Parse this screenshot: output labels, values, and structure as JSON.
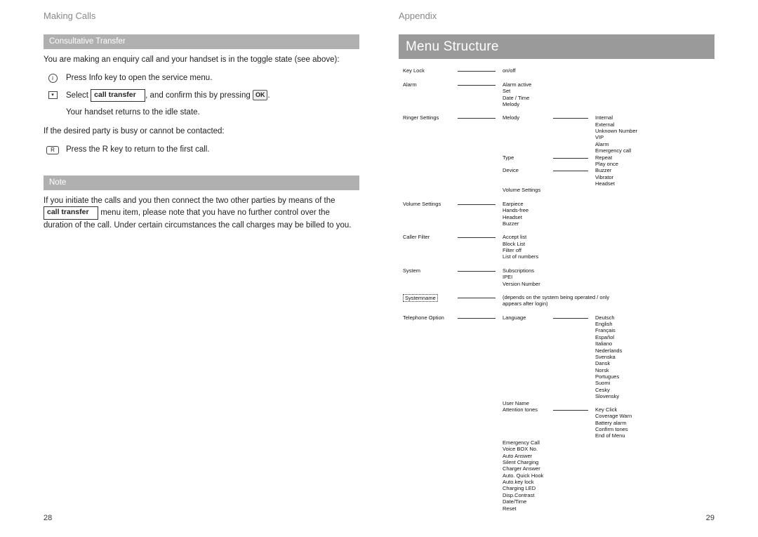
{
  "left": {
    "heading": "Making Calls",
    "consultative_heading": "Consultative Transfer",
    "intro": "You are making an enquiry call and your handset is in the toggle state (see above):",
    "step1": "Press Info key to open the service menu.",
    "step2a": "Select",
    "step2_box": "call transfer",
    "step2b": ", and confirm this by pressing",
    "ok_label": "OK",
    "step2c": ".",
    "step3": "Your handset returns to the idle state.",
    "busy_intro": "If the desired party is busy or cannot be contacted:",
    "busy_step": "Press the R key to return to the first call.",
    "note_heading": "Note",
    "note1": "If you initiate the calls and you then connect the two other parties by means of the",
    "note_box": "call transfer",
    "note2": " menu item, please note that you have no further control over the duration of the call. Under certain circumstances the call charges may be billed to you.",
    "page_num": "28"
  },
  "right": {
    "heading": "Appendix",
    "title": "Menu Structure",
    "page_num": "29",
    "menu": {
      "keylock": {
        "label": "Key Lock",
        "items": [
          "on/off"
        ]
      },
      "alarm": {
        "label": "Alarm",
        "items": [
          "Alarm active",
          "Set",
          "Date / Time",
          "Melody"
        ]
      },
      "ringer": {
        "label": "Ringer Settings",
        "melody": {
          "label": "Melody",
          "items": [
            "Internal",
            "External",
            "Unknown Number",
            "VIP",
            "Alarm",
            "Emergency call"
          ]
        },
        "type": {
          "label": "Type",
          "items": [
            "Repeat",
            "Play once"
          ]
        },
        "device": {
          "label": "Device",
          "items": [
            "Buzzer",
            "Vibrator",
            "Headset"
          ]
        },
        "last": "Volume Settings"
      },
      "volume": {
        "label": "Volume Settings",
        "items": [
          "Earpiece",
          "Hands-free",
          "Headset",
          "Buzzer"
        ]
      },
      "caller": {
        "label": "Caller Filter",
        "items": [
          "Accept list",
          "Block List",
          "Filter off",
          "List of numbers"
        ]
      },
      "system": {
        "label": "System",
        "items": [
          "Subscriptions",
          "IPEI",
          "Version Number"
        ]
      },
      "systemname": {
        "label": "Systemname",
        "note": "(depends on the system being operated / only appears after login)"
      },
      "telephone": {
        "label": "Telephone Option",
        "language": {
          "label": "Language",
          "items": [
            "Deutsch",
            "English",
            "Français",
            "Español",
            "Italiano",
            "Nederlands",
            "Svenska",
            "Dansk",
            "Norsk",
            "Portugues",
            "Suomi",
            "Cesky",
            "Slovensky"
          ]
        },
        "username": "User Name",
        "attention": {
          "label": "Attention tones",
          "items": [
            "Key Click",
            "Coverage Warn",
            "Battery alarm",
            "Confirm tones",
            "End of Menu"
          ]
        },
        "rest": [
          "Emergency Call",
          "Voice BOX No.",
          "Auto Answer",
          "Silent Charging",
          "Charger Answer",
          "Auto. Quick Hook",
          "Auto.key lock",
          "Charging LED",
          "Disp.Contrast",
          "Date/Time",
          "Reset"
        ]
      }
    }
  }
}
